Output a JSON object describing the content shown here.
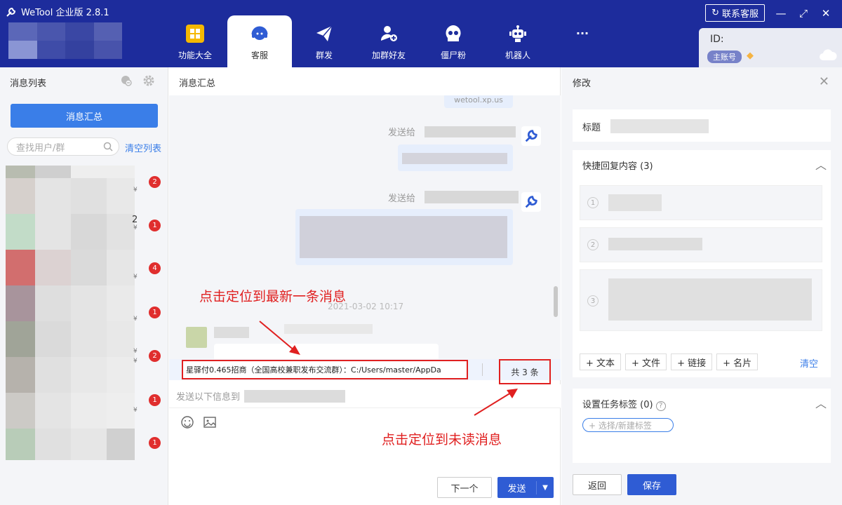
{
  "app": {
    "title": "WeTool 企业版 2.8.1"
  },
  "nav": [
    {
      "label": "功能大全",
      "icon": "grid-icon"
    },
    {
      "label": "客服",
      "icon": "headset-icon"
    },
    {
      "label": "群发",
      "icon": "paper-plane-icon"
    },
    {
      "label": "加群好友",
      "icon": "add-user-icon"
    },
    {
      "label": "僵尸粉",
      "icon": "skull-icon"
    },
    {
      "label": "机器人",
      "icon": "robot-icon"
    },
    {
      "label": "···",
      "icon": "more-icon"
    }
  ],
  "header": {
    "support_label": "联系客服",
    "id_label": "ID:",
    "account_badge": "主账号"
  },
  "left": {
    "title": "消息列表",
    "summary_button": "消息汇总",
    "search_placeholder": "查找用户/群",
    "clear_list": "清空列表",
    "badges": [
      "2",
      "1",
      "4",
      "1",
      "2",
      "1",
      "1"
    ],
    "row_hints": [
      "¥",
      "2",
      "¥",
      "¥",
      "¥",
      "¥",
      "¥",
      "¥"
    ]
  },
  "middle": {
    "title": "消息汇总",
    "bubble_top_text": "wetool.xp.us",
    "send_to_1": "发送给",
    "send_to_2": "发送给",
    "timestamp": "2021-03-02 10:17",
    "notice_text": "星驿付0.465招商（全国高校兼职发布交流群）：C:/Users/master/AppDa",
    "count_text": "共 3 条",
    "send_hint": "发送以下信息到",
    "next_button": "下一个",
    "send_button": "发送",
    "annotation_latest": "点击定位到最新一条消息",
    "annotation_unread": "点击定位到未读消息"
  },
  "right": {
    "title": "修改",
    "title_label": "标题",
    "quick_reply_label": "快捷回复内容",
    "quick_reply_count": "(3)",
    "reply_numbers": [
      "1",
      "2",
      "3"
    ],
    "add_buttons": [
      "+ 文本",
      "+ 文件",
      "+ 链接",
      "+ 名片"
    ],
    "clear": "清空",
    "tag_label": "设置任务标签",
    "tag_count": "(0)",
    "tag_placeholder": "+ 选择/新建标签",
    "back_button": "返回",
    "save_button": "保存"
  },
  "colors": {
    "topbar": "#1d2c9c",
    "accent": "#3a7ee8",
    "primary_button": "#2f5cd4",
    "annotation": "#e02020",
    "badge": "#e02e2e"
  }
}
